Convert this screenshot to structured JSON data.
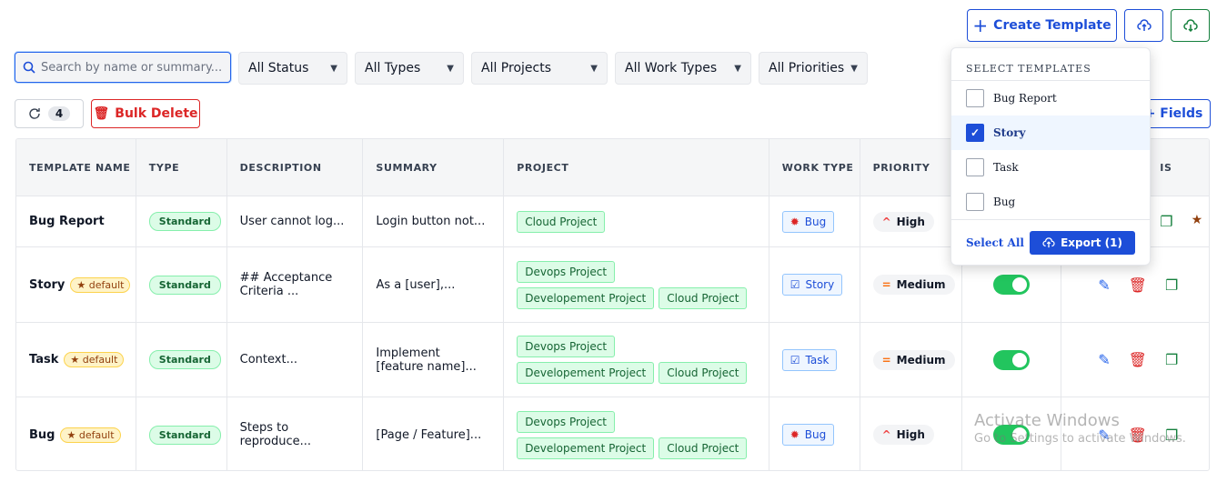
{
  "toolbar": {
    "create_template": "Create Template",
    "upload_icon": "cloud-upload-icon",
    "download_icon": "cloud-download-icon"
  },
  "filters": {
    "search_placeholder": "Search by name or summary...",
    "status": "All Status",
    "types": "All Types",
    "projects": "All Projects",
    "work_types": "All Work Types",
    "priorities": "All Priorities"
  },
  "actions": {
    "refresh_count": "4",
    "bulk_delete": "Bulk Delete",
    "fields": "+ Fields"
  },
  "table": {
    "headers": [
      "TEMPLATE NAME",
      "TYPE",
      "DESCRIPTION",
      "SUMMARY",
      "PROJECT",
      "WORK TYPE",
      "PRIORITY",
      "",
      "IS"
    ],
    "rows": [
      {
        "name": "Bug Report",
        "default": "",
        "type": "Standard",
        "description": "User cannot log...",
        "summary": "Login button not...",
        "projects": [
          "Cloud Project"
        ],
        "work_type": "Bug",
        "priority": "High"
      },
      {
        "name": "Story",
        "default": "★ default",
        "type": "Standard",
        "description": "## Acceptance Criteria ...",
        "summary": "As a [user],...",
        "projects": [
          "Devops Project",
          "Developement Project",
          "Cloud Project"
        ],
        "work_type": "Story",
        "priority": "Medium"
      },
      {
        "name": "Task",
        "default": "★ default",
        "type": "Standard",
        "description": "Context...",
        "summary": "Implement [feature name]...",
        "projects": [
          "Devops Project",
          "Developement Project",
          "Cloud Project"
        ],
        "work_type": "Task",
        "priority": "Medium"
      },
      {
        "name": "Bug",
        "default": "★ default",
        "type": "Standard",
        "description": "Steps to reproduce...",
        "summary": "[Page / Feature]...",
        "projects": [
          "Devops Project",
          "Developement Project",
          "Cloud Project"
        ],
        "work_type": "Bug",
        "priority": "High"
      }
    ]
  },
  "dropdown": {
    "title": "SELECT TEMPLATES",
    "items": [
      "Bug Report",
      "Story",
      "Task",
      "Bug"
    ],
    "select_all": "Select All",
    "export": "Export (1)"
  },
  "watermark": {
    "line1": "Activate Windows",
    "line2": "Go to Settings to activate Windows."
  },
  "colors": {
    "accent": "#1d4ed8",
    "danger": "#dc2626",
    "success": "#22c55e"
  }
}
